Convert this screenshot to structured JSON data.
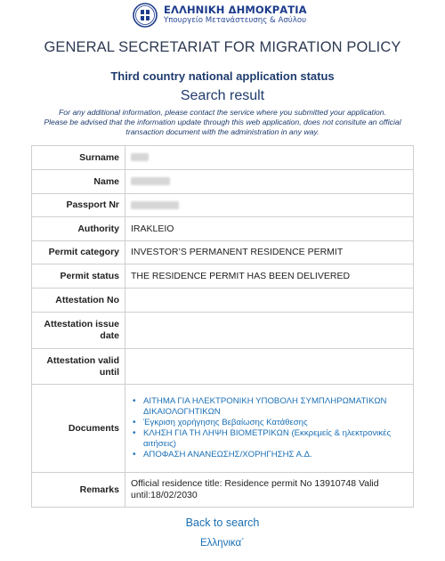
{
  "header": {
    "logo_title": "ΕΛΛΗΝΙΚΗ ΔΗΜΟΚΡΑΤΙΑ",
    "logo_subtitle": "Υπουργείο Μετανάστευσης & Ασύλου",
    "brand_color": "#1e3c8c"
  },
  "page": {
    "secretariat": "GENERAL SECRETARIAT FOR MIGRATION POLICY",
    "app_status_title": "Third country national application status",
    "search_result_title": "Search result",
    "notice_line1": "For any additional information, please contact the service where you submitted your application.",
    "notice_line2": "Please be advised that the information update through this web application, does not consitute an official transaction document with the administration in any way."
  },
  "result": {
    "surname_label": "Surname",
    "name_label": "Name",
    "passport_label": "Passport Nr",
    "authority_label": "Authority",
    "authority_value": "IRAKLEIO",
    "permit_category_label": "Permit category",
    "permit_category_value": "INVESTOR’S PERMANENT RESIDENCE PERMIT",
    "permit_status_label": "Permit status",
    "permit_status_value": "THE RESIDENCE PERMIT HAS BEEN DELIVERED",
    "attestation_no_label": "Attestation No",
    "attestation_no_value": "",
    "attestation_issue_label": "Attestation issue date",
    "attestation_issue_value": "",
    "attestation_valid_label": "Attestation valid until",
    "attestation_valid_value": "",
    "documents_label": "Documents",
    "documents": [
      "ΑΙΤΗΜΑ ΓΙΑ ΗΛΕΚΤΡΟΝΙΚΗ ΥΠΟΒΟΛΗ ΣΥΜΠΛΗΡΩΜΑΤΙΚΩΝ ΔΙΚΑΙΟΛΟΓΗΤΙΚΩΝ",
      "Έγκριση χορήγησης Βεβαίωσης Κατάθεσης",
      "ΚΛΗΣΗ ΓΙΑ ΤΗ ΛΗΨΗ ΒΙΟΜΕΤΡΙΚΩΝ (Εκκρεμείς & ηλεκτρονικές αιτήσεις)",
      "ΑΠΟΦΑΣΗ ΑΝΑΝΕΩΣΗΣ/ΧΟΡΗΓΗΣΗΣ Α.Δ."
    ],
    "remarks_label": "Remarks",
    "remarks_value": "Official residence title: Residence permit No 13910748 Valid until:18/02/2030"
  },
  "footer": {
    "back_link": "Back to search",
    "language_link": "Ελληνικα´"
  },
  "colors": {
    "link": "#1a6fb4",
    "heading": "#1f3c6e",
    "border": "#cfcfcf"
  }
}
